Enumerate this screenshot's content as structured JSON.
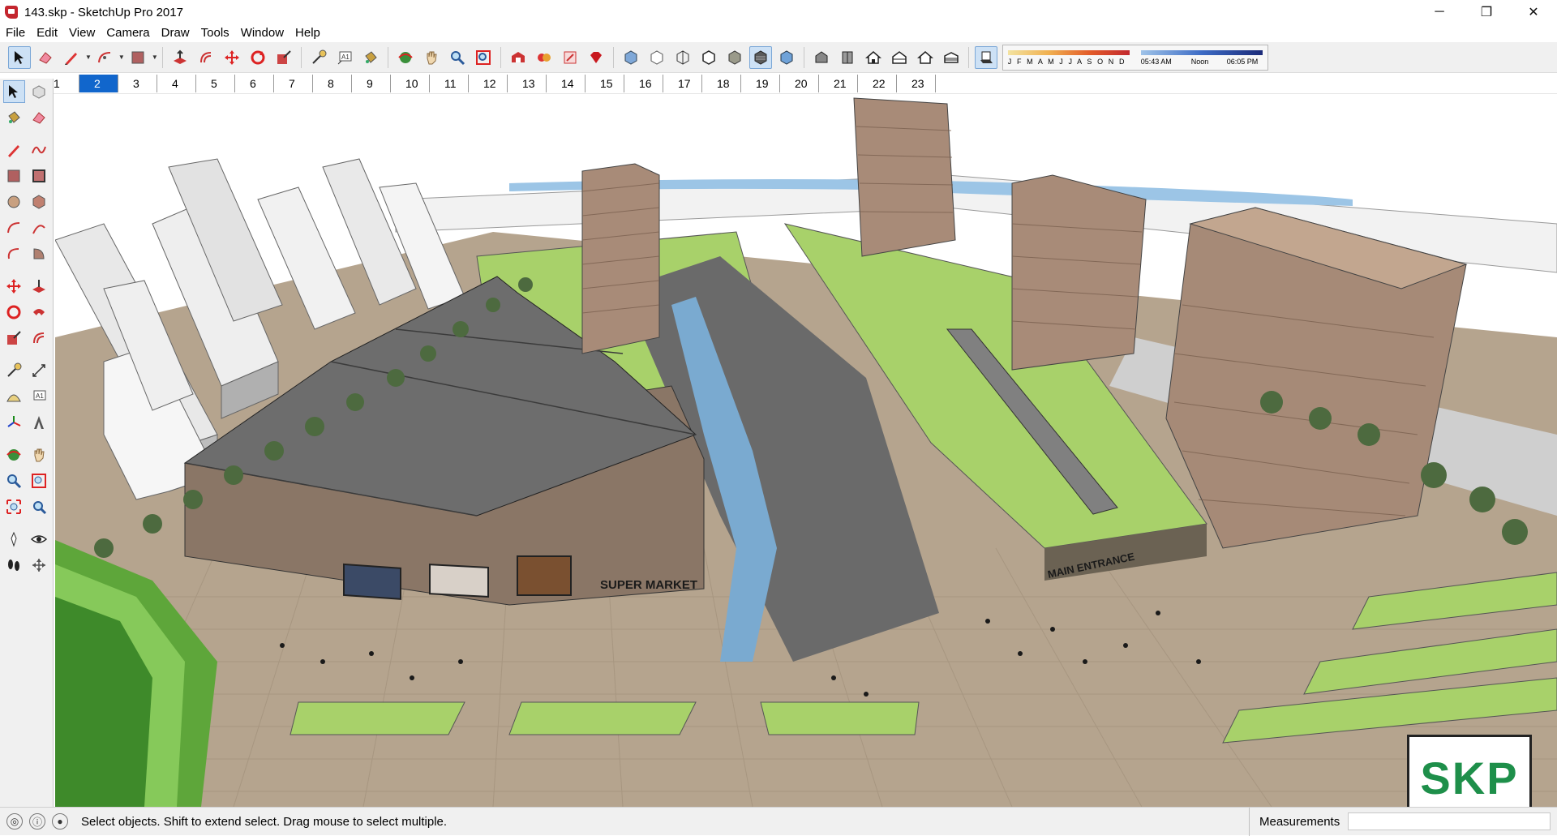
{
  "window": {
    "title": "143.skp - SketchUp Pro 2017",
    "controls": [
      "─",
      "❐",
      "✕"
    ]
  },
  "menu": [
    "File",
    "Edit",
    "View",
    "Camera",
    "Draw",
    "Tools",
    "Window",
    "Help"
  ],
  "toolbar": {
    "shadow_months": "J F M A M J J A S O N D",
    "shadow_time_start": "05:43 AM",
    "shadow_time_mid": "Noon",
    "shadow_time_end": "06:05 PM"
  },
  "scenes": {
    "tabs": [
      "1",
      "2",
      "3",
      "4",
      "5",
      "6",
      "7",
      "8",
      "9",
      "10",
      "11",
      "12",
      "13",
      "14",
      "15",
      "16",
      "17",
      "18",
      "19",
      "20",
      "21",
      "22",
      "23"
    ],
    "active": "2"
  },
  "model_labels": {
    "supermarket": "SUPER MARKET",
    "main_entrance": "MAIN ENTRANCE"
  },
  "logo": "SKP",
  "status": {
    "hint": "Select objects. Shift to extend select. Drag mouse to select multiple.",
    "measurements_label": "Measurements",
    "measurements_value": ""
  },
  "colors": {
    "accent": "#1166cc",
    "ground": "#b5a48e",
    "grass": "#a8d16a",
    "roof": "#6d6d6d",
    "water": "#7aaad0",
    "logo": "#1e8f4a"
  }
}
